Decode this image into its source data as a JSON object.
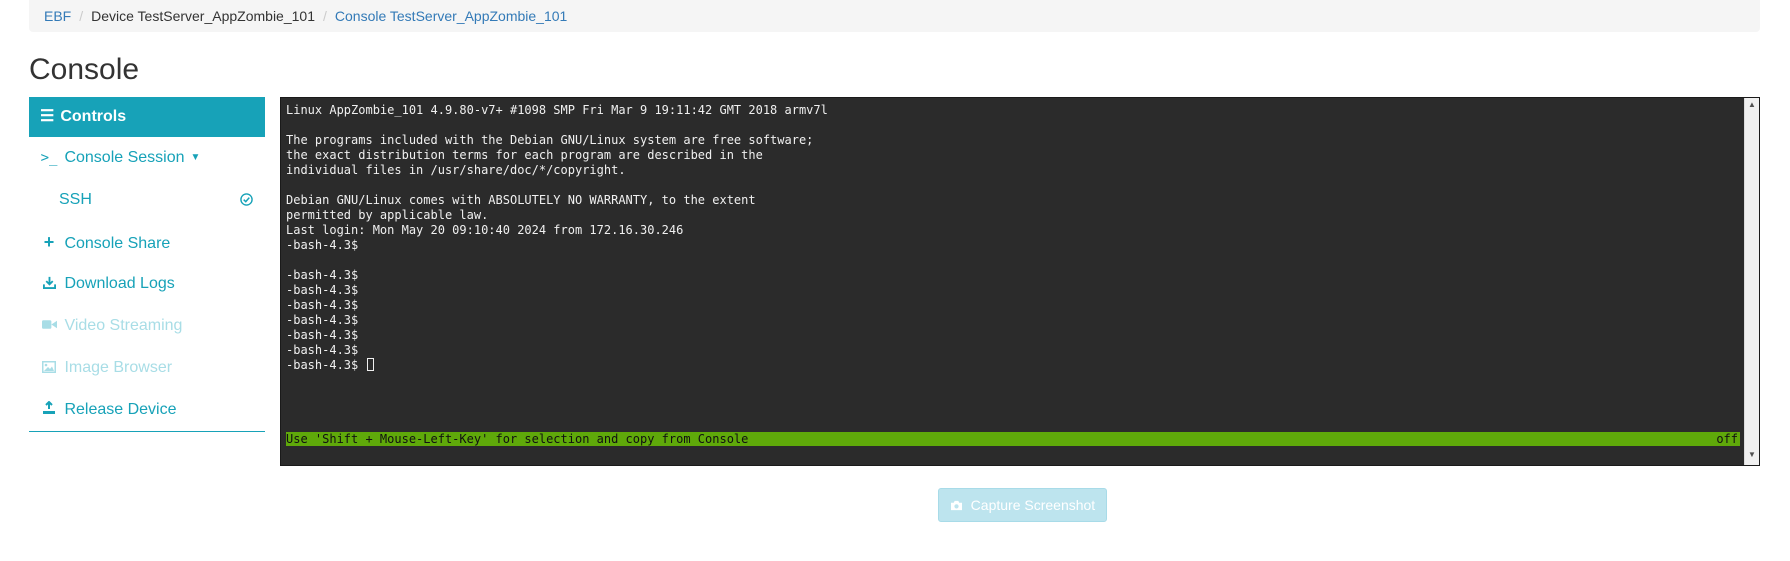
{
  "breadcrumb": {
    "root": "EBF",
    "device": "Device TestServer_AppZombie_101",
    "current": "Console TestServer_AppZombie_101"
  },
  "page": {
    "title": "Console"
  },
  "sidebar": {
    "header": {
      "icon": "bars-icon",
      "label": "Controls"
    },
    "items": [
      {
        "icon": "terminal-icon",
        "label": "Console Session",
        "caret": "▼",
        "enabled": true
      },
      {
        "label": "SSH",
        "status_icon": "check-circle-icon",
        "enabled": true
      },
      {
        "icon": "plus-icon",
        "label": "Console Share",
        "enabled": true
      },
      {
        "icon": "download-icon",
        "label": "Download Logs",
        "enabled": true
      },
      {
        "icon": "video-camera-icon",
        "label": "Video Streaming",
        "enabled": false
      },
      {
        "icon": "image-icon",
        "label": "Image Browser",
        "enabled": false
      },
      {
        "icon": "release-icon",
        "label": "Release Device",
        "enabled": true
      }
    ]
  },
  "terminal": {
    "lines": [
      "Linux AppZombie_101 4.9.80-v7+ #1098 SMP Fri Mar 9 19:11:42 GMT 2018 armv7l",
      "",
      "The programs included with the Debian GNU/Linux system are free software;",
      "the exact distribution terms for each program are described in the",
      "individual files in /usr/share/doc/*/copyright.",
      "",
      "Debian GNU/Linux comes with ABSOLUTELY NO WARRANTY, to the extent",
      "permitted by applicable law.",
      "Last login: Mon May 20 09:10:40 2024 from 172.16.30.246",
      "-bash-4.3$",
      "",
      "-bash-4.3$",
      "-bash-4.3$",
      "-bash-4.3$",
      "-bash-4.3$",
      "-bash-4.3$",
      "-bash-4.3$",
      "-bash-4.3$ "
    ],
    "status_text": "Use 'Shift + Mouse-Left-Key' for selection and copy from Console",
    "status_right": "off",
    "background": "#2b2b2b",
    "status_color": "#5fa90a"
  },
  "capture_button": {
    "icon": "camera-icon",
    "label": "Capture Screenshot",
    "enabled": false
  },
  "colors": {
    "accent": "#17a2b8",
    "link": "#337ab7"
  }
}
